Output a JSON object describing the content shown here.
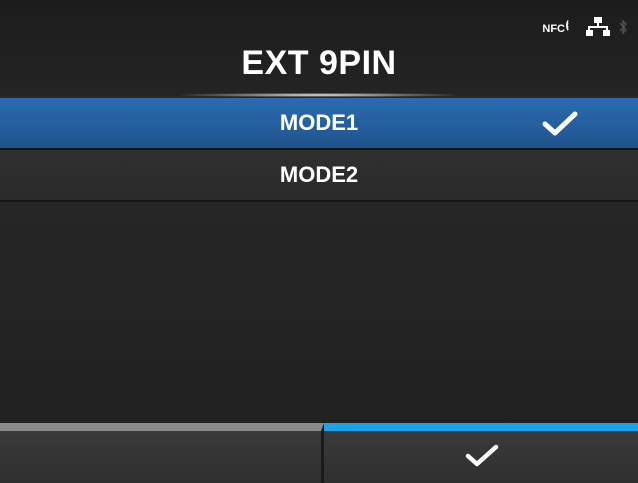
{
  "header": {
    "title": "EXT 9PIN",
    "status_icons": {
      "nfc_label": "NFC",
      "nfc_icon": "nfc-icon",
      "network_icon": "network-icon",
      "bluetooth_icon": "bluetooth-icon"
    }
  },
  "list": {
    "items": [
      {
        "label": "MODE1",
        "selected": true,
        "icon": "check-icon"
      },
      {
        "label": "MODE2",
        "selected": false
      }
    ]
  },
  "softkeys": {
    "left": {
      "icon": ""
    },
    "right": {
      "icon": "check-icon"
    }
  },
  "colors": {
    "selected_row": "#245e9c",
    "left_softkey_bar": "#8a8a8a",
    "right_softkey_bar": "#1aa3e8"
  }
}
